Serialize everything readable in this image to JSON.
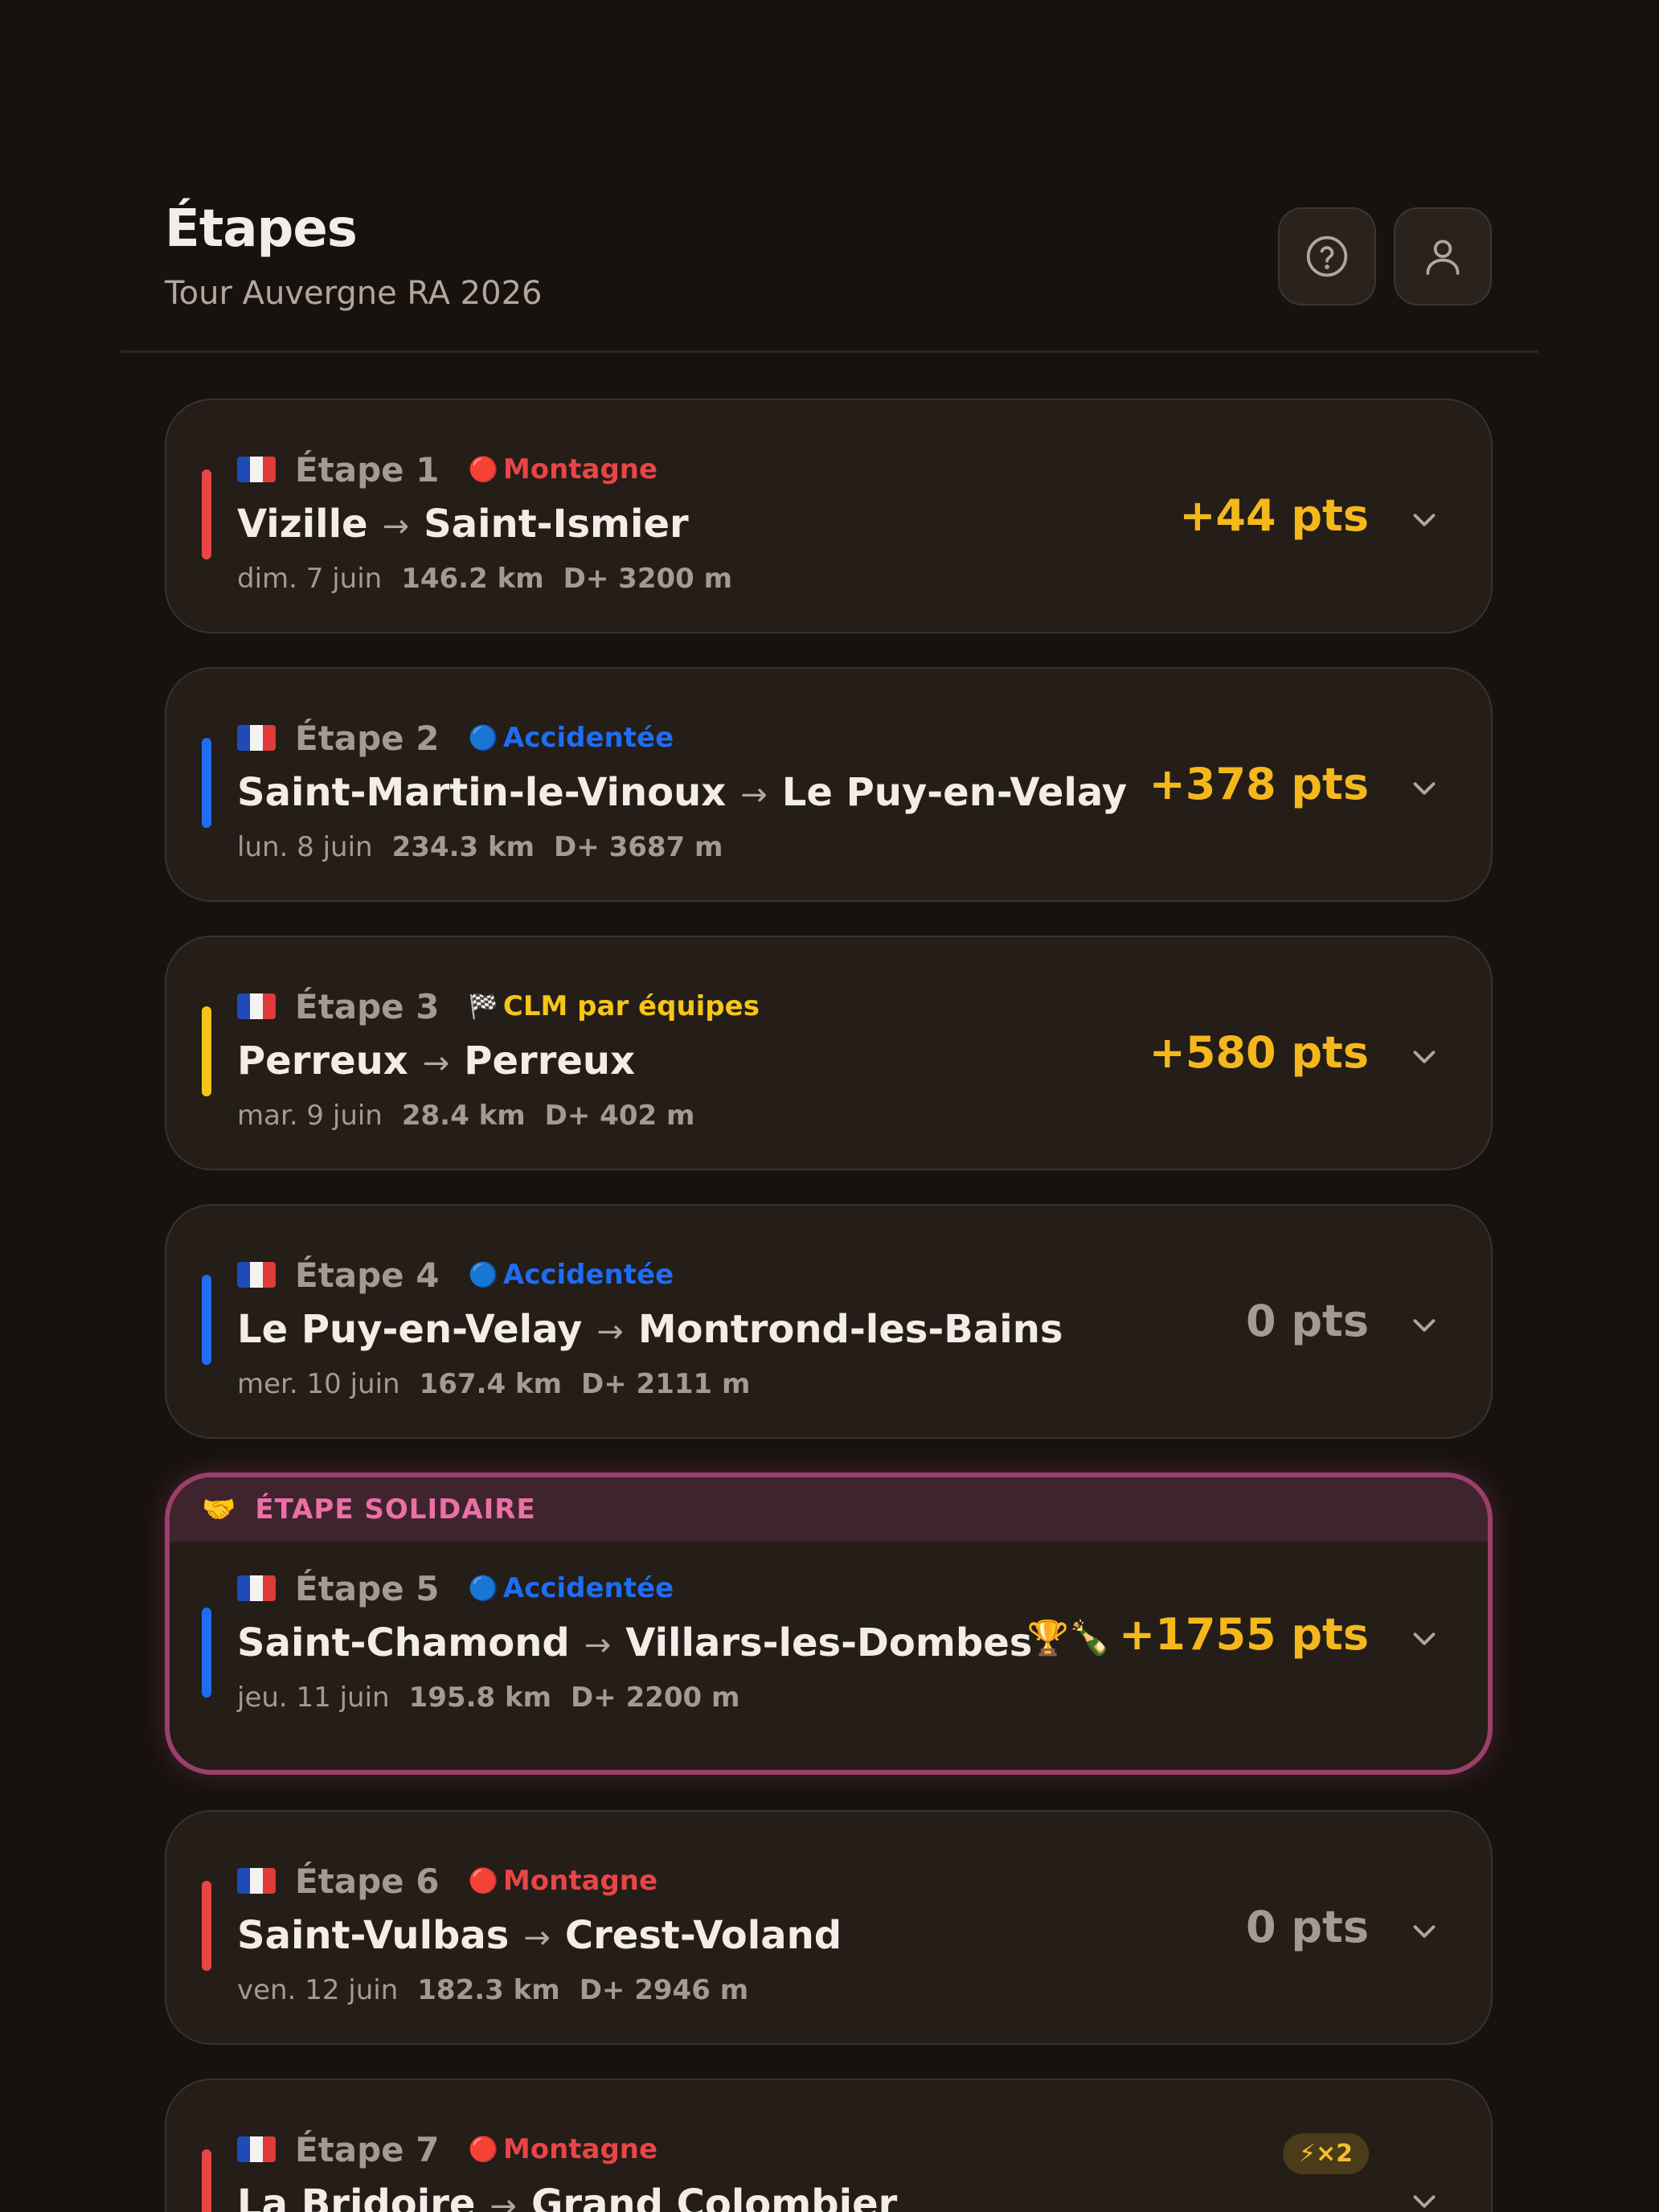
{
  "header": {
    "title": "Étapes",
    "subtitle": "Tour Auvergne RA 2026",
    "help_icon": "help-circle-icon",
    "user_icon": "user-icon"
  },
  "colors": {
    "montagne": "#e94545",
    "accidentee": "#1e6df2",
    "clm": "#f5c518",
    "points": "#f5b81c",
    "zero_points": "#a59a90",
    "solidaire": "#ec6fa6"
  },
  "stages": [
    {
      "stage": "Étape 1",
      "type": "Montagne",
      "type_icon": "🔴",
      "from": "Vizille",
      "to": "Saint-Ismier",
      "date": "dim. 7 juin",
      "distance": "146.2 km",
      "elevation": "D+ 3200 m",
      "points": "+44 pts"
    },
    {
      "stage": "Étape 2",
      "type": "Accidentée",
      "type_icon": "🔵",
      "from": "Saint-Martin-le-Vinoux",
      "to": "Le Puy-en-Velay",
      "date": "lun. 8 juin",
      "distance": "234.3 km",
      "elevation": "D+ 3687 m",
      "points": "+378 pts"
    },
    {
      "stage": "Étape 3",
      "type": "CLM par équipes",
      "type_icon": "🏁",
      "from": "Perreux",
      "to": "Perreux",
      "date": "mar. 9 juin",
      "distance": "28.4 km",
      "elevation": "D+ 402 m",
      "points": "+580 pts"
    },
    {
      "stage": "Étape 4",
      "type": "Accidentée",
      "type_icon": "🔵",
      "from": "Le Puy-en-Velay",
      "to": "Montrond-les-Bains",
      "date": "mer. 10 juin",
      "distance": "167.4 km",
      "elevation": "D+ 2111 m",
      "points": "0 pts"
    },
    {
      "banner": "ÉTAPE SOLIDAIRE",
      "banner_icon": "🤝",
      "stage": "Étape 5",
      "type": "Accidentée",
      "type_icon": "🔵",
      "from": "Saint-Chamond",
      "to": "Villars-les-Dombes",
      "date": "jeu. 11 juin",
      "distance": "195.8 km",
      "elevation": "D+ 2200 m",
      "trophies": "🏆🍾",
      "points": "+1755 pts"
    },
    {
      "stage": "Étape 6",
      "type": "Montagne",
      "type_icon": "🔴",
      "from": "Saint-Vulbas",
      "to": "Crest-Voland",
      "date": "ven. 12 juin",
      "distance": "182.3 km",
      "elevation": "D+ 2946 m",
      "points": "0 pts"
    },
    {
      "stage": "Étape 7",
      "type": "Montagne",
      "type_icon": "🔴",
      "from": "La Bridoire",
      "to": "Grand Colombier",
      "multiplier": "⚡×2"
    }
  ]
}
